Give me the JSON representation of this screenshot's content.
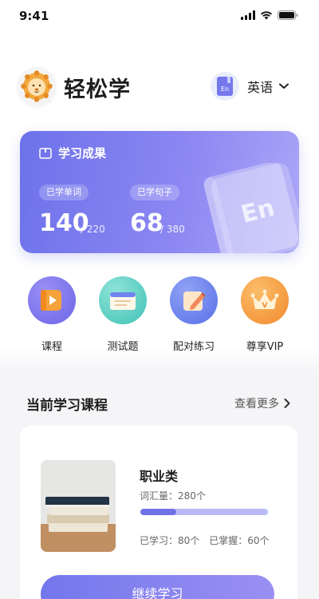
{
  "status_bar": {
    "time": "9:41"
  },
  "header": {
    "app_title": "轻松学",
    "language": "英语",
    "lang_badge_text": "En"
  },
  "achievements": {
    "title": "学习成果",
    "words": {
      "label": "已学单词",
      "value": "140",
      "total": "/ 220"
    },
    "sentences": {
      "label": "已学句子",
      "value": "68",
      "total": "/ 380"
    },
    "book_text": "En"
  },
  "quick_menu": [
    {
      "label": "课程",
      "icon": "play-book-icon"
    },
    {
      "label": "测试题",
      "icon": "notebook-icon"
    },
    {
      "label": "配对练习",
      "icon": "pencil-note-icon"
    },
    {
      "label": "尊享VIP",
      "icon": "crown-icon"
    }
  ],
  "current_courses": {
    "title": "当前学习课程",
    "more_label": "查看更多",
    "course": {
      "name": "职业类",
      "vocab": "词汇量：280个",
      "progress": 0.28,
      "learned": "已学习：80个",
      "mastered": "已掌握：60个"
    },
    "continue_label": "继续学习"
  },
  "colors": {
    "accent": "#6f72e6",
    "accent_light": "#b8bbf3"
  }
}
